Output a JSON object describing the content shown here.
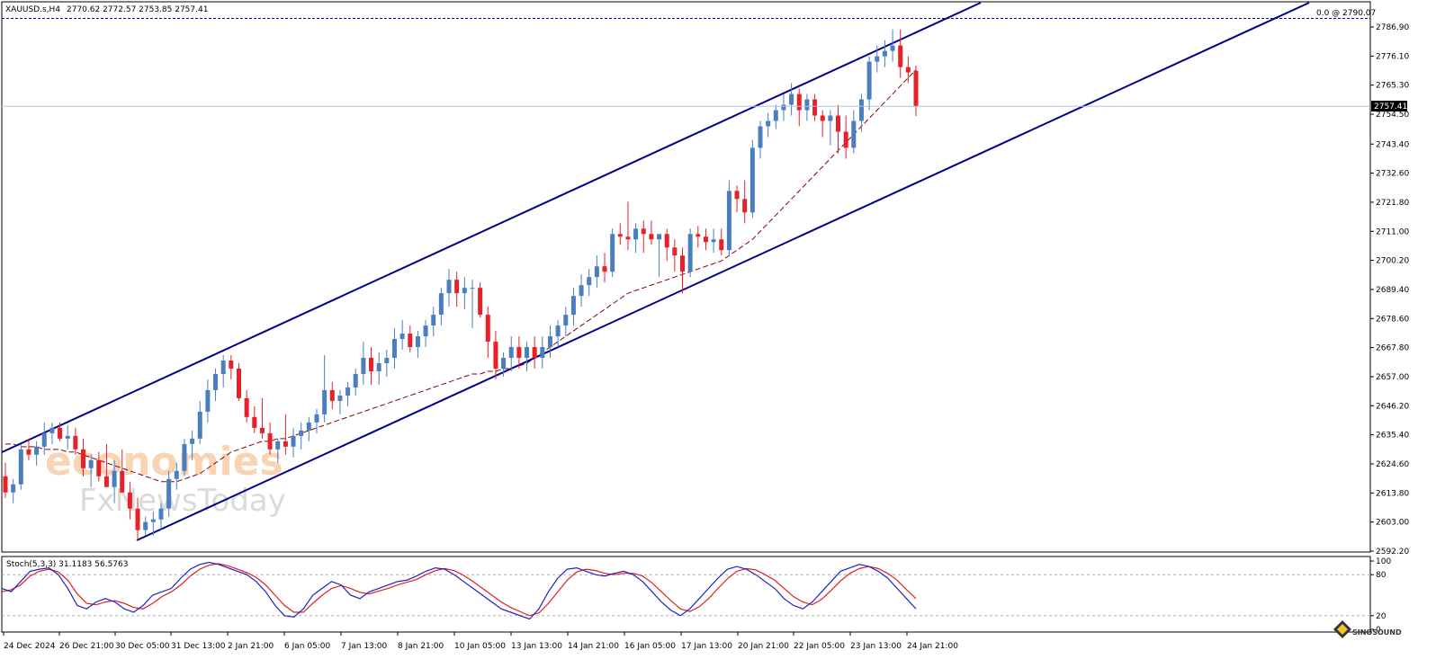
{
  "header": {
    "symbol": "XAUUSD.s,H4",
    "ohlc": "2770.62 2772.57 2753.85 2757.41"
  },
  "fib_label": "0.0 @ 2790.07",
  "current_price_label": "2757.41",
  "watermark": {
    "line1": "economies",
    "line2": "FxNewsToday",
    "corner": "SINOSOUND"
  },
  "colors": {
    "bull": "#4a7fbf",
    "bear": "#e8202a",
    "channel": "#00008b",
    "ma": "#8b0000",
    "stoch_main": "#2020c0",
    "stoch_signal": "#e02020",
    "grid": "#c8c8c8"
  },
  "chart_data": [
    {
      "type": "candlestick",
      "title": "",
      "xlabel": "",
      "ylabel": "",
      "ylim": [
        2592.2,
        2790.07
      ],
      "yticks": [
        "2786.90",
        "2776.10",
        "2765.30",
        "2754.50",
        "2743.40",
        "2732.60",
        "2721.80",
        "2711.00",
        "2700.20",
        "2689.40",
        "2678.60",
        "2667.80",
        "2657.00",
        "2646.20",
        "2635.40",
        "2624.60",
        "2613.80",
        "2603.00",
        "2592.20"
      ],
      "xticks": [
        "24 Dec 2024",
        "26 Dec 21:00",
        "30 Dec 05:00",
        "31 Dec 13:00",
        "2 Jan 21:00",
        "6 Jan 05:00",
        "7 Jan 13:00",
        "8 Jan 21:00",
        "10 Jan 05:00",
        "13 Jan 13:00",
        "14 Jan 21:00",
        "16 Jan 05:00",
        "17 Jan 13:00",
        "20 Jan 21:00",
        "22 Jan 05:00",
        "23 Jan 13:00",
        "24 Jan 21:00"
      ],
      "ohlc": [
        [
          2620,
          2625,
          2612,
          2614
        ],
        [
          2614,
          2619,
          2610,
          2617
        ],
        [
          2617,
          2632,
          2615,
          2630
        ],
        [
          2630,
          2634,
          2626,
          2628
        ],
        [
          2628,
          2633,
          2624,
          2631
        ],
        [
          2631,
          2640,
          2628,
          2636
        ],
        [
          2636,
          2640,
          2632,
          2638
        ],
        [
          2638,
          2640,
          2633,
          2634
        ],
        [
          2634,
          2639,
          2630,
          2635
        ],
        [
          2635,
          2638,
          2628,
          2630
        ],
        [
          2630,
          2634,
          2620,
          2623
        ],
        [
          2623,
          2628,
          2616,
          2626
        ],
        [
          2626,
          2629,
          2618,
          2620
        ],
        [
          2620,
          2632,
          2616,
          2616
        ],
        [
          2616,
          2626,
          2610,
          2622
        ],
        [
          2622,
          2630,
          2614,
          2614
        ],
        [
          2614,
          2618,
          2604,
          2608
        ],
        [
          2608,
          2612,
          2596,
          2600
        ],
        [
          2600,
          2605,
          2598,
          2603
        ],
        [
          2603,
          2607,
          2598,
          2604
        ],
        [
          2604,
          2610,
          2600,
          2608
        ],
        [
          2608,
          2622,
          2605,
          2619
        ],
        [
          2619,
          2625,
          2615,
          2622
        ],
        [
          2622,
          2634,
          2620,
          2632
        ],
        [
          2632,
          2637,
          2626,
          2634
        ],
        [
          2634,
          2648,
          2632,
          2644
        ],
        [
          2644,
          2656,
          2640,
          2652
        ],
        [
          2652,
          2660,
          2648,
          2658
        ],
        [
          2658,
          2665,
          2653,
          2663
        ],
        [
          2663,
          2665,
          2656,
          2660
        ],
        [
          2660,
          2662,
          2648,
          2649
        ],
        [
          2649,
          2652,
          2640,
          2642
        ],
        [
          2642,
          2646,
          2636,
          2638
        ],
        [
          2638,
          2649,
          2634,
          2636
        ],
        [
          2636,
          2640,
          2628,
          2630
        ],
        [
          2630,
          2634,
          2625,
          2633
        ],
        [
          2633,
          2643,
          2628,
          2631
        ],
        [
          2631,
          2638,
          2627,
          2635
        ],
        [
          2635,
          2640,
          2630,
          2637
        ],
        [
          2637,
          2642,
          2633,
          2640
        ],
        [
          2640,
          2645,
          2636,
          2643
        ],
        [
          2643,
          2665,
          2640,
          2652
        ],
        [
          2652,
          2655,
          2645,
          2648
        ],
        [
          2648,
          2652,
          2643,
          2650
        ],
        [
          2650,
          2655,
          2646,
          2653
        ],
        [
          2653,
          2660,
          2650,
          2658
        ],
        [
          2658,
          2670,
          2654,
          2664
        ],
        [
          2664,
          2668,
          2654,
          2659
        ],
        [
          2659,
          2666,
          2654,
          2662
        ],
        [
          2662,
          2667,
          2657,
          2664
        ],
        [
          2664,
          2675,
          2660,
          2671
        ],
        [
          2671,
          2678,
          2667,
          2673
        ],
        [
          2673,
          2676,
          2666,
          2668
        ],
        [
          2668,
          2674,
          2664,
          2672
        ],
        [
          2672,
          2678,
          2668,
          2676
        ],
        [
          2676,
          2683,
          2672,
          2680
        ],
        [
          2680,
          2690,
          2676,
          2688
        ],
        [
          2688,
          2697,
          2683,
          2693
        ],
        [
          2693,
          2696,
          2683,
          2688
        ],
        [
          2688,
          2694,
          2682,
          2690
        ],
        [
          2690,
          2693,
          2675,
          2690
        ],
        [
          2690,
          2692,
          2679,
          2680
        ],
        [
          2680,
          2683,
          2664,
          2670
        ],
        [
          2670,
          2674,
          2656,
          2660
        ],
        [
          2660,
          2666,
          2657,
          2664
        ],
        [
          2664,
          2672,
          2659,
          2668
        ],
        [
          2668,
          2672,
          2660,
          2664
        ],
        [
          2664,
          2670,
          2659,
          2668
        ],
        [
          2668,
          2672,
          2660,
          2664
        ],
        [
          2664,
          2672,
          2660,
          2668
        ],
        [
          2668,
          2676,
          2664,
          2672
        ],
        [
          2672,
          2678,
          2668,
          2676
        ],
        [
          2676,
          2683,
          2672,
          2680
        ],
        [
          2680,
          2690,
          2676,
          2687
        ],
        [
          2687,
          2695,
          2683,
          2691
        ],
        [
          2691,
          2697,
          2687,
          2694
        ],
        [
          2694,
          2702,
          2690,
          2698
        ],
        [
          2698,
          2703,
          2692,
          2696
        ],
        [
          2696,
          2712,
          2694,
          2710
        ],
        [
          2710,
          2714,
          2706,
          2709
        ],
        [
          2709,
          2722,
          2704,
          2708
        ],
        [
          2708,
          2714,
          2703,
          2712
        ],
        [
          2712,
          2715,
          2703,
          2710
        ],
        [
          2710,
          2715,
          2706,
          2708
        ],
        [
          2708,
          2710,
          2694,
          2710
        ],
        [
          2710,
          2712,
          2700,
          2705
        ],
        [
          2705,
          2708,
          2696,
          2702
        ],
        [
          2702,
          2705,
          2688,
          2696
        ],
        [
          2696,
          2712,
          2694,
          2710
        ],
        [
          2710,
          2713,
          2705,
          2709
        ],
        [
          2709,
          2712,
          2704,
          2707
        ],
        [
          2707,
          2712,
          2703,
          2708
        ],
        [
          2708,
          2712,
          2702,
          2704
        ],
        [
          2704,
          2730,
          2702,
          2726
        ],
        [
          2726,
          2728,
          2718,
          2723
        ],
        [
          2723,
          2730,
          2714,
          2718
        ],
        [
          2718,
          2745,
          2716,
          2742
        ],
        [
          2742,
          2752,
          2738,
          2750
        ],
        [
          2750,
          2755,
          2746,
          2752
        ],
        [
          2752,
          2758,
          2749,
          2756
        ],
        [
          2756,
          2762,
          2752,
          2758
        ],
        [
          2758,
          2766,
          2754,
          2762
        ],
        [
          2762,
          2764,
          2750,
          2756
        ],
        [
          2756,
          2762,
          2752,
          2760
        ],
        [
          2760,
          2762,
          2752,
          2754
        ],
        [
          2754,
          2756,
          2746,
          2752
        ],
        [
          2752,
          2756,
          2743,
          2754
        ],
        [
          2754,
          2758,
          2740,
          2748
        ],
        [
          2748,
          2754,
          2738,
          2742
        ],
        [
          2742,
          2756,
          2740,
          2752
        ],
        [
          2752,
          2762,
          2748,
          2760
        ],
        [
          2760,
          2776,
          2756,
          2774
        ],
        [
          2774,
          2780,
          2770,
          2776
        ],
        [
          2776,
          2782,
          2772,
          2778
        ],
        [
          2778,
          2786,
          2774,
          2780
        ],
        [
          2780,
          2786,
          2768,
          2772
        ],
        [
          2772,
          2776,
          2766,
          2770
        ],
        [
          2770.62,
          2772.57,
          2753.85,
          2757.41
        ]
      ],
      "series": [
        {
          "name": "",
          "type": "ma_dashed",
          "values": [
            2632,
            2632,
            2631,
            2631,
            2631,
            2630,
            2630,
            2630,
            2629,
            2629,
            2628,
            2627,
            2626,
            2625,
            2624,
            2623,
            2622,
            2621,
            2620,
            2619,
            2618,
            2618,
            2618,
            2619,
            2620,
            2621,
            2623,
            2625,
            2627,
            2629,
            2630,
            2631,
            2632,
            2633,
            2633,
            2634,
            2634,
            2635,
            2636,
            2637,
            2638,
            2639,
            2640,
            2641,
            2642,
            2643,
            2644,
            2645,
            2646,
            2647,
            2648,
            2649,
            2650,
            2651,
            2652,
            2653,
            2654,
            2655,
            2656,
            2657,
            2658,
            2658,
            2659,
            2659,
            2660,
            2660,
            2661,
            2662,
            2664,
            2666,
            2668,
            2670,
            2672,
            2674,
            2676,
            2678,
            2680,
            2682,
            2684,
            2686,
            2688,
            2689,
            2690,
            2691,
            2692,
            2693,
            2694,
            2695,
            2696,
            2697,
            2698,
            2699,
            2700,
            2702,
            2704,
            2706,
            2708,
            2711,
            2714,
            2717,
            2720,
            2723,
            2726,
            2729,
            2732,
            2735,
            2738,
            2741,
            2744,
            2747,
            2750,
            2753,
            2756,
            2759,
            2762,
            2765,
            2768,
            2771
          ]
        },
        {
          "name": "",
          "type": "stoch_main",
          "values": [
            60,
            55,
            70,
            85,
            88,
            90,
            80,
            60,
            35,
            30,
            40,
            45,
            40,
            30,
            25,
            35,
            50,
            55,
            60,
            75,
            88,
            95,
            98,
            95,
            90,
            85,
            80,
            70,
            55,
            35,
            20,
            18,
            30,
            50,
            60,
            70,
            65,
            50,
            45,
            55,
            60,
            65,
            70,
            72,
            78,
            85,
            90,
            88,
            80,
            70,
            60,
            50,
            40,
            30,
            25,
            20,
            15,
            30,
            55,
            75,
            88,
            90,
            85,
            80,
            78,
            82,
            85,
            80,
            70,
            55,
            40,
            28,
            20,
            30,
            45,
            60,
            75,
            88,
            92,
            88,
            80,
            70,
            60,
            45,
            35,
            30,
            40,
            55,
            70,
            85,
            90,
            95,
            92,
            85,
            75,
            60,
            45,
            30
          ]
        },
        {
          "name": "",
          "type": "stoch_signal",
          "values": [
            55,
            58,
            65,
            78,
            85,
            88,
            84,
            72,
            52,
            38,
            36,
            40,
            42,
            38,
            32,
            30,
            38,
            48,
            55,
            65,
            78,
            88,
            94,
            96,
            93,
            88,
            83,
            76,
            65,
            50,
            35,
            25,
            25,
            38,
            50,
            60,
            64,
            60,
            54,
            52,
            56,
            60,
            65,
            69,
            73,
            80,
            86,
            89,
            86,
            79,
            70,
            60,
            50,
            40,
            32,
            26,
            20,
            24,
            38,
            55,
            72,
            84,
            88,
            86,
            82,
            80,
            82,
            82,
            78,
            68,
            55,
            42,
            30,
            26,
            33,
            45,
            60,
            74,
            85,
            89,
            87,
            80,
            72,
            60,
            48,
            40,
            36,
            44,
            57,
            71,
            82,
            89,
            92,
            89,
            82,
            72,
            58,
            45
          ]
        }
      ],
      "stoch_label": "Stoch(5,3,3) 31.1183 56.5763",
      "stoch_ylim": [
        0,
        100
      ],
      "stoch_ticks": [
        "100",
        "80",
        "20",
        "0"
      ],
      "channel": "ascending, two parallel lines",
      "grid": false,
      "legend": "none"
    }
  ]
}
